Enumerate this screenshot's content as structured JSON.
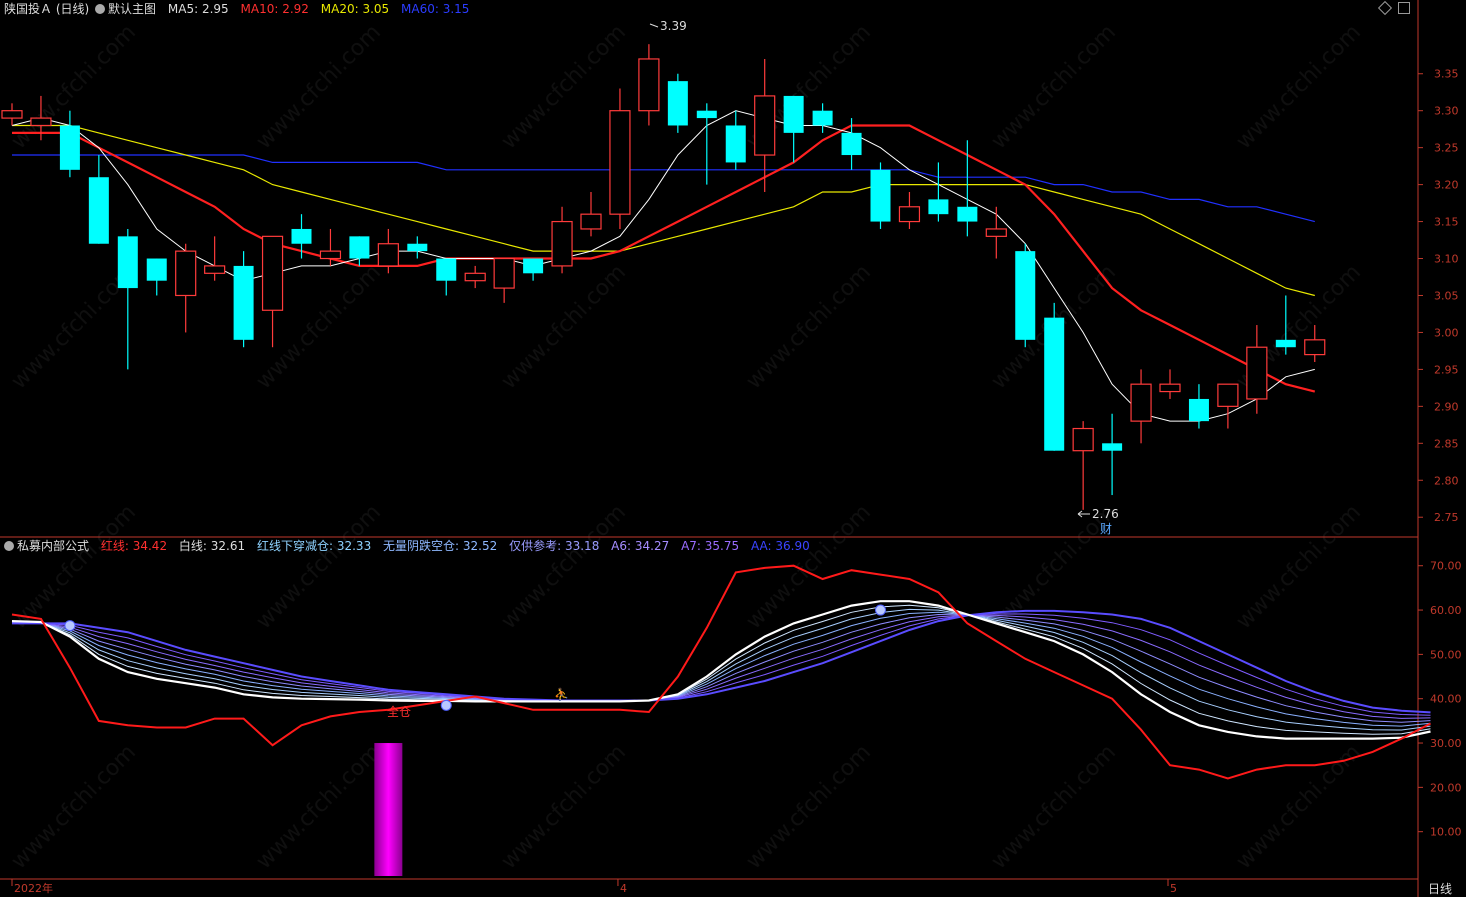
{
  "header_main": {
    "stock": "陕国投Ａ",
    "period": "(日线)",
    "template": "默认主图",
    "ma5_label": "MA5:",
    "ma5": "2.95",
    "ma10_label": "MA10:",
    "ma10": "2.92",
    "ma20_label": "MA20:",
    "ma20": "3.05",
    "ma60_label": "MA60:",
    "ma60": "3.15"
  },
  "header_ind": {
    "name": "私募内部公式",
    "red_label": "红线:",
    "red": "34.42",
    "white_label": "白线:",
    "white": "32.61",
    "s1_label": "红线下穿减仓:",
    "s1": "32.33",
    "s2_label": "无量阴跌空仓:",
    "s2": "32.52",
    "s3_label": "仅供参考:",
    "s3": "33.18",
    "a6_label": "A6:",
    "a6": "34.27",
    "a7_label": "A7:",
    "a7": "35.75",
    "aa_label": "AA:",
    "aa": "36.90"
  },
  "labels": {
    "high": "3.39",
    "low": "2.76",
    "cai": "财",
    "quancang": "全仓",
    "period_button": "日线"
  },
  "colors": {
    "up": "#ff3b3b",
    "down": "#00ffff",
    "ma5": "#ffffff",
    "ma10": "#ff2020",
    "ma20": "#e8e800",
    "ma60": "#2030ff",
    "axis": "#c0392b",
    "magenta": "#ff00ff"
  },
  "chart_data": [
    {
      "type": "candlestick",
      "y_ticks": [
        "3.35",
        "3.30",
        "3.25",
        "3.20",
        "3.15",
        "3.10",
        "3.05",
        "3.00",
        "2.95",
        "2.90",
        "2.85",
        "2.80",
        "2.75"
      ],
      "ylim": [
        2.73,
        3.42
      ],
      "x_ticks": [
        {
          "label": "2022年",
          "index": 0
        },
        {
          "label": "4",
          "index": 21
        },
        {
          "label": "5",
          "index": 40
        }
      ],
      "candles": [
        {
          "o": 3.29,
          "c": 3.3,
          "h": 3.31,
          "l": 3.28
        },
        {
          "o": 3.28,
          "c": 3.29,
          "h": 3.32,
          "l": 3.26
        },
        {
          "o": 3.28,
          "c": 3.22,
          "h": 3.3,
          "l": 3.21
        },
        {
          "o": 3.21,
          "c": 3.12,
          "h": 3.24,
          "l": 3.12
        },
        {
          "o": 3.13,
          "c": 3.06,
          "h": 3.14,
          "l": 2.95
        },
        {
          "o": 3.1,
          "c": 3.07,
          "h": 3.1,
          "l": 3.05
        },
        {
          "o": 3.05,
          "c": 3.11,
          "h": 3.12,
          "l": 3.0
        },
        {
          "o": 3.08,
          "c": 3.09,
          "h": 3.13,
          "l": 3.07
        },
        {
          "o": 3.09,
          "c": 2.99,
          "h": 3.11,
          "l": 2.98
        },
        {
          "o": 3.03,
          "c": 3.13,
          "h": 3.13,
          "l": 2.98
        },
        {
          "o": 3.14,
          "c": 3.12,
          "h": 3.16,
          "l": 3.1
        },
        {
          "o": 3.1,
          "c": 3.11,
          "h": 3.14,
          "l": 3.09
        },
        {
          "o": 3.13,
          "c": 3.1,
          "h": 3.13,
          "l": 3.09
        },
        {
          "o": 3.09,
          "c": 3.12,
          "h": 3.14,
          "l": 3.08
        },
        {
          "o": 3.12,
          "c": 3.11,
          "h": 3.13,
          "l": 3.1
        },
        {
          "o": 3.1,
          "c": 3.07,
          "h": 3.1,
          "l": 3.05
        },
        {
          "o": 3.07,
          "c": 3.08,
          "h": 3.09,
          "l": 3.06
        },
        {
          "o": 3.06,
          "c": 3.1,
          "h": 3.1,
          "l": 3.04
        },
        {
          "o": 3.1,
          "c": 3.08,
          "h": 3.1,
          "l": 3.07
        },
        {
          "o": 3.09,
          "c": 3.15,
          "h": 3.17,
          "l": 3.08
        },
        {
          "o": 3.14,
          "c": 3.16,
          "h": 3.19,
          "l": 3.13
        },
        {
          "o": 3.16,
          "c": 3.3,
          "h": 3.33,
          "l": 3.14
        },
        {
          "o": 3.3,
          "c": 3.37,
          "h": 3.39,
          "l": 3.28
        },
        {
          "o": 3.34,
          "c": 3.28,
          "h": 3.35,
          "l": 3.27
        },
        {
          "o": 3.3,
          "c": 3.29,
          "h": 3.31,
          "l": 3.2
        },
        {
          "o": 3.28,
          "c": 3.23,
          "h": 3.3,
          "l": 3.22
        },
        {
          "o": 3.24,
          "c": 3.32,
          "h": 3.37,
          "l": 3.19
        },
        {
          "o": 3.32,
          "c": 3.27,
          "h": 3.32,
          "l": 3.23
        },
        {
          "o": 3.3,
          "c": 3.28,
          "h": 3.31,
          "l": 3.27
        },
        {
          "o": 3.27,
          "c": 3.24,
          "h": 3.29,
          "l": 3.22
        },
        {
          "o": 3.22,
          "c": 3.15,
          "h": 3.23,
          "l": 3.14
        },
        {
          "o": 3.15,
          "c": 3.17,
          "h": 3.19,
          "l": 3.14
        },
        {
          "o": 3.18,
          "c": 3.16,
          "h": 3.23,
          "l": 3.15
        },
        {
          "o": 3.17,
          "c": 3.15,
          "h": 3.26,
          "l": 3.13
        },
        {
          "o": 3.13,
          "c": 3.14,
          "h": 3.17,
          "l": 3.1
        },
        {
          "o": 3.11,
          "c": 2.99,
          "h": 3.12,
          "l": 2.98
        },
        {
          "o": 3.02,
          "c": 2.84,
          "h": 3.04,
          "l": 2.84
        },
        {
          "o": 2.84,
          "c": 2.87,
          "h": 2.88,
          "l": 2.76
        },
        {
          "o": 2.85,
          "c": 2.84,
          "h": 2.89,
          "l": 2.78
        },
        {
          "o": 2.88,
          "c": 2.93,
          "h": 2.95,
          "l": 2.85
        },
        {
          "o": 2.92,
          "c": 2.93,
          "h": 2.95,
          "l": 2.91
        },
        {
          "o": 2.91,
          "c": 2.88,
          "h": 2.93,
          "l": 2.87
        },
        {
          "o": 2.9,
          "c": 2.93,
          "h": 2.93,
          "l": 2.87
        },
        {
          "o": 2.91,
          "c": 2.98,
          "h": 3.01,
          "l": 2.89
        },
        {
          "o": 2.99,
          "c": 2.98,
          "h": 3.05,
          "l": 2.97
        },
        {
          "o": 2.97,
          "c": 2.99,
          "h": 3.01,
          "l": 2.96
        }
      ],
      "ma5": [
        3.28,
        3.29,
        3.28,
        3.25,
        3.2,
        3.14,
        3.11,
        3.09,
        3.07,
        3.08,
        3.09,
        3.09,
        3.1,
        3.11,
        3.11,
        3.1,
        3.1,
        3.1,
        3.09,
        3.1,
        3.11,
        3.13,
        3.18,
        3.24,
        3.28,
        3.3,
        3.29,
        3.28,
        3.28,
        3.27,
        3.25,
        3.22,
        3.2,
        3.18,
        3.16,
        3.12,
        3.06,
        3.0,
        2.93,
        2.89,
        2.88,
        2.88,
        2.89,
        2.91,
        2.94,
        2.95
      ],
      "ma10": [
        3.27,
        3.27,
        3.27,
        3.25,
        3.23,
        3.21,
        3.19,
        3.17,
        3.14,
        3.12,
        3.11,
        3.1,
        3.09,
        3.09,
        3.09,
        3.1,
        3.1,
        3.1,
        3.1,
        3.1,
        3.1,
        3.11,
        3.13,
        3.15,
        3.17,
        3.19,
        3.21,
        3.23,
        3.26,
        3.28,
        3.28,
        3.28,
        3.26,
        3.24,
        3.22,
        3.2,
        3.16,
        3.11,
        3.06,
        3.03,
        3.01,
        2.99,
        2.97,
        2.95,
        2.93,
        2.92
      ],
      "ma20": [
        3.28,
        3.28,
        3.28,
        3.27,
        3.26,
        3.25,
        3.24,
        3.23,
        3.22,
        3.2,
        3.19,
        3.18,
        3.17,
        3.16,
        3.15,
        3.14,
        3.13,
        3.12,
        3.11,
        3.11,
        3.11,
        3.11,
        3.12,
        3.13,
        3.14,
        3.15,
        3.16,
        3.17,
        3.19,
        3.19,
        3.2,
        3.2,
        3.2,
        3.2,
        3.2,
        3.2,
        3.19,
        3.18,
        3.17,
        3.16,
        3.14,
        3.12,
        3.1,
        3.08,
        3.06,
        3.05
      ],
      "ma60": [
        3.24,
        3.24,
        3.24,
        3.24,
        3.24,
        3.24,
        3.24,
        3.24,
        3.24,
        3.23,
        3.23,
        3.23,
        3.23,
        3.23,
        3.23,
        3.22,
        3.22,
        3.22,
        3.22,
        3.22,
        3.22,
        3.22,
        3.22,
        3.22,
        3.22,
        3.22,
        3.22,
        3.22,
        3.22,
        3.22,
        3.22,
        3.22,
        3.21,
        3.21,
        3.21,
        3.21,
        3.2,
        3.2,
        3.19,
        3.19,
        3.18,
        3.18,
        3.17,
        3.17,
        3.16,
        3.15
      ]
    },
    {
      "type": "line",
      "y_ticks": [
        "70.00",
        "60.00",
        "50.00",
        "40.00",
        "30.00",
        "20.00",
        "10.00"
      ],
      "ylim": [
        0,
        74
      ],
      "red": [
        59,
        58,
        47,
        35,
        34,
        33.5,
        33.5,
        35.5,
        35.5,
        29.5,
        34,
        36,
        37,
        37.5,
        38.5,
        39.5,
        40.5,
        39,
        37.5,
        37.5,
        37.5,
        37.5,
        37,
        45,
        56,
        68.5,
        69.5,
        70,
        67,
        69,
        68,
        67,
        64,
        57,
        53,
        49,
        46,
        43,
        40,
        33,
        25,
        24,
        22,
        24,
        25,
        25,
        26,
        28,
        31,
        34.4
      ],
      "white": [
        57.5,
        57.3,
        54,
        49,
        46,
        44.5,
        43.5,
        42.5,
        41,
        40.3,
        40,
        39.9,
        39.8,
        39.6,
        39.5,
        39.5,
        39.4,
        39.4,
        39.4,
        39.4,
        39.4,
        39.4,
        39.6,
        41,
        45,
        50,
        54,
        57,
        59,
        61,
        62,
        62,
        61,
        59,
        57,
        55,
        53,
        50,
        46,
        41,
        37,
        34,
        32.5,
        31.5,
        31,
        31,
        31,
        31,
        31.2,
        32.6
      ],
      "aa": [
        57,
        57,
        57,
        56,
        55,
        53,
        51,
        49.5,
        48,
        46.5,
        45,
        44,
        43,
        42,
        41.5,
        41,
        40.5,
        40,
        39.8,
        39.6,
        39.6,
        39.6,
        39.6,
        40,
        41,
        42.5,
        44,
        46,
        48,
        50.5,
        53,
        55.5,
        57.5,
        58.8,
        59.5,
        59.8,
        59.8,
        59.5,
        59,
        58,
        56,
        53,
        50,
        47,
        44,
        41.5,
        39.5,
        38,
        37.3,
        36.9
      ],
      "magenta_bar": {
        "index": 13,
        "low": 0,
        "high": 30
      }
    }
  ]
}
